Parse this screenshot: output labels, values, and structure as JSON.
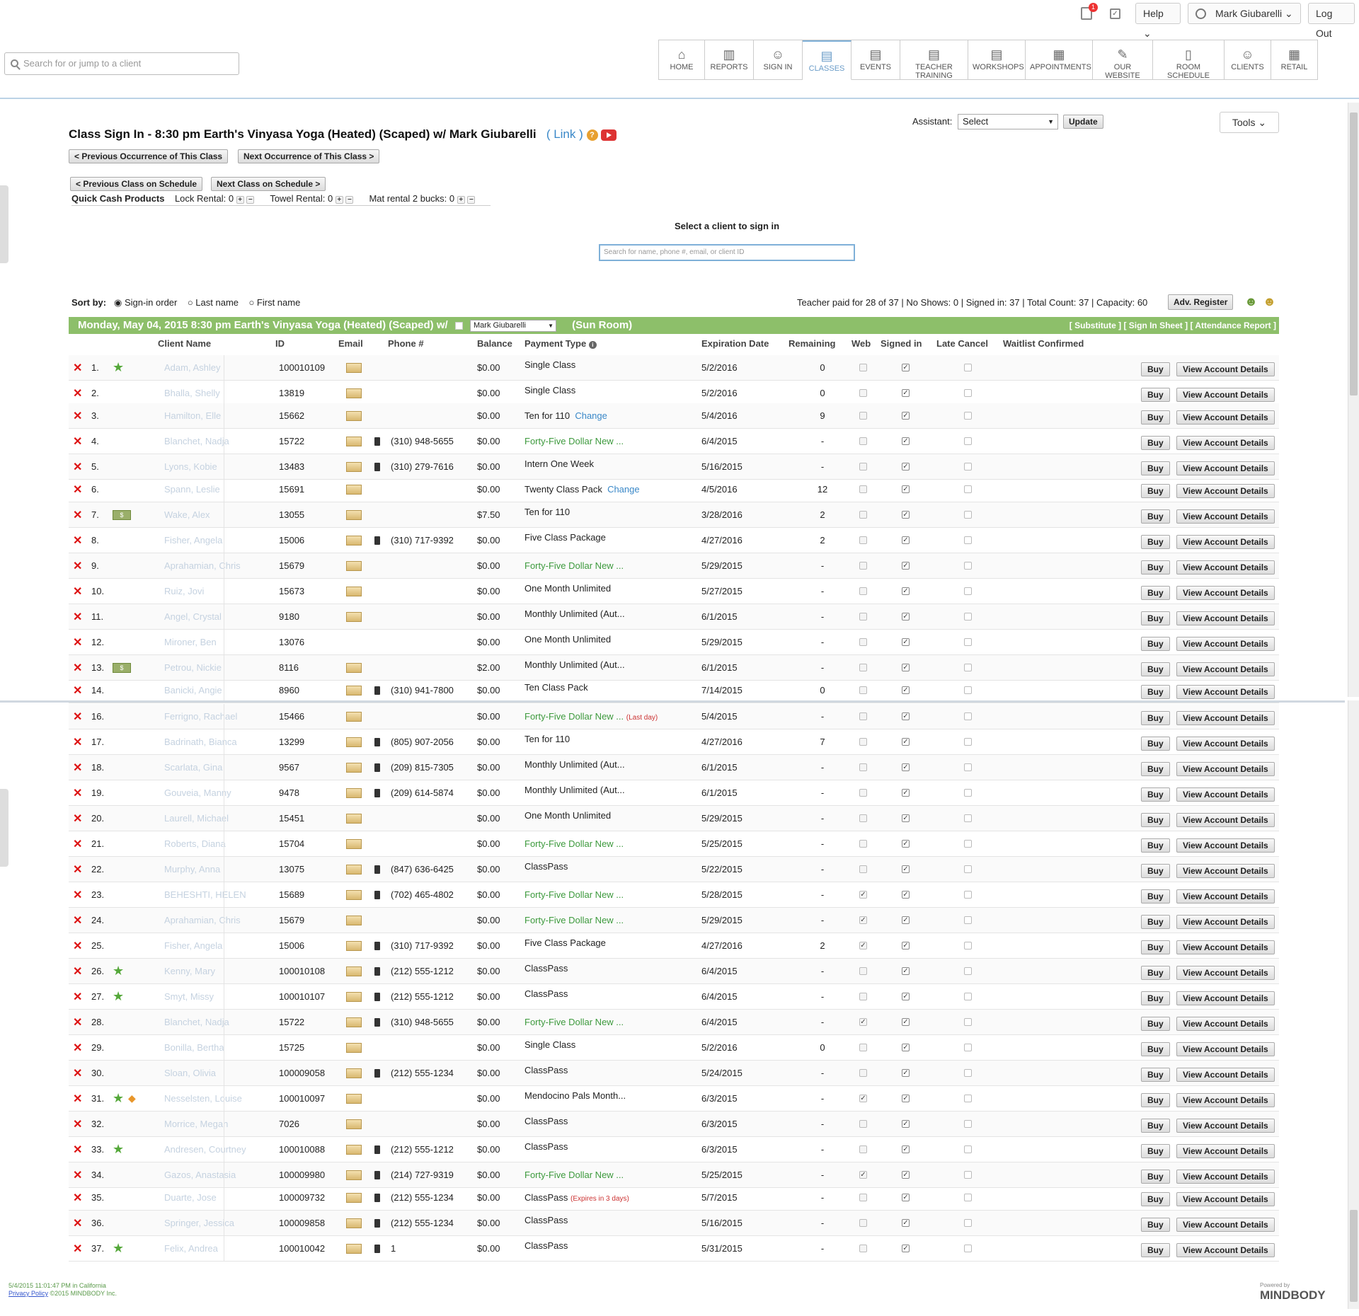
{
  "top": {
    "help": "Help",
    "user": "Mark Giubarelli",
    "logout": "Log Out",
    "badge": "1"
  },
  "search": {
    "placeholder": "Search for or jump to a client"
  },
  "nav": [
    {
      "label": "HOME",
      "icon": "home-icon",
      "glyph": "⌂"
    },
    {
      "label": "REPORTS",
      "icon": "reports-icon",
      "glyph": "▥"
    },
    {
      "label": "SIGN IN",
      "icon": "sign-in-icon",
      "glyph": "☺"
    },
    {
      "label": "CLASSES",
      "icon": "classes-icon",
      "glyph": "▤"
    },
    {
      "label": "EVENTS",
      "icon": "events-icon",
      "glyph": "▤"
    },
    {
      "label": "TEACHER TRAINING",
      "icon": "teacher-training-icon",
      "glyph": "▤"
    },
    {
      "label": "WORKSHOPS",
      "icon": "workshops-icon",
      "glyph": "▤"
    },
    {
      "label": "APPOINTMENTS",
      "icon": "appointments-icon",
      "glyph": "▦"
    },
    {
      "label": "OUR WEBSITE",
      "icon": "website-icon",
      "glyph": "✎"
    },
    {
      "label": "ROOM SCHEDULE",
      "icon": "room-schedule-icon",
      "glyph": "▯"
    },
    {
      "label": "CLIENTS",
      "icon": "clients-icon",
      "glyph": "☺"
    },
    {
      "label": "RETAIL",
      "icon": "retail-icon",
      "glyph": "▦"
    }
  ],
  "assistant": {
    "label": "Assistant:",
    "select": "Select",
    "update": "Update"
  },
  "tools": "Tools",
  "page_title": {
    "text": "Class Sign In  -  8:30 pm   Earth's Vinyasa Yoga (Heated) (Scaped) w/  Mark Giubarelli",
    "link": "Link",
    "help": "?"
  },
  "buttons": {
    "prev_occ": "< Previous Occurrence of This Class",
    "next_occ": "Next Occurrence of This Class >",
    "prev_class": "< Previous Class on Schedule",
    "next_class": "Next Class on Schedule >"
  },
  "quick_cash": {
    "label": "Quick Cash Products",
    "items": [
      {
        "name": "Lock Rental:",
        "count": "0"
      },
      {
        "name": "Towel Rental:",
        "count": "0"
      },
      {
        "name": "Mat rental 2 bucks:",
        "count": "0"
      }
    ]
  },
  "client_search": {
    "label": "Select a client to sign in",
    "placeholder": "Search for name, phone #, email, or client ID"
  },
  "sort": {
    "label": "Sort by:",
    "options": [
      "Sign-in order",
      "Last name",
      "First name"
    ]
  },
  "stats": "Teacher paid for 28 of 37 | No Shows: 0 | Signed in: 37 |  Total Count: 37  | Capacity: 60",
  "adv_register": "Adv. Register",
  "class_bar": {
    "text": "Monday, May 04, 2015   8:30 pm   Earth's Vinyasa Yoga (Heated) (Scaped)    w/",
    "teacher": "Mark Giubarelli",
    "room": "(Sun Room)",
    "links": "[ Substitute ]   [ Sign In Sheet ]   [ Attendance Report ]"
  },
  "columns": {
    "name": "Client Name",
    "id": "ID",
    "email": "Email",
    "phone": "Phone #",
    "balance": "Balance",
    "payment": "Payment Type",
    "exp": "Expiration Date",
    "remaining": "Remaining",
    "web": "Web",
    "signed": "Signed in",
    "late": "Late Cancel",
    "waitlist": "Waitlist Confirmed"
  },
  "row_buttons": {
    "buy": "Buy",
    "view": "View Account Details"
  },
  "rows": [
    {
      "n": "1.",
      "name": "Adam, Ashley",
      "id": "100010109",
      "email": true,
      "phone": "",
      "bal": "$0.00",
      "pay": "Single Class",
      "exp": "5/2/2016",
      "rem": "0",
      "star": true
    },
    {
      "n": "2.",
      "name": "Bhalla, Shelly",
      "id": "13819",
      "email": true,
      "phone": "",
      "bal": "$0.00",
      "pay": "Single Class",
      "exp": "5/2/2016",
      "rem": "0"
    },
    {
      "n": "3.",
      "name": "Hamilton, Elle",
      "id": "15662",
      "email": true,
      "phone": "",
      "bal": "$0.00",
      "pay": "Ten for 110",
      "change": "Change",
      "exp": "5/4/2016",
      "rem": "9"
    },
    {
      "n": "4.",
      "name": "Blanchet, Nadja",
      "id": "15722",
      "email": true,
      "phone": "(310) 948-5655",
      "bal": "$0.00",
      "pay": "Forty-Five Dollar New ...",
      "green": true,
      "exp": "6/4/2015",
      "rem": "-"
    },
    {
      "n": "5.",
      "name": "Lyons, Kobie",
      "id": "13483",
      "email": true,
      "phone": "(310) 279-7616",
      "bal": "$0.00",
      "pay": "Intern One Week",
      "exp": "5/16/2015",
      "rem": "-"
    },
    {
      "n": "6.",
      "name": "Spann, Leslie",
      "id": "15691",
      "email": true,
      "phone": "",
      "bal": "$0.00",
      "pay": "Twenty Class Pack",
      "change": "Change",
      "exp": "4/5/2016",
      "rem": "12"
    },
    {
      "n": "7.",
      "name": "Wake, Alex",
      "id": "13055",
      "email": true,
      "phone": "",
      "bal": "$7.50",
      "pay": "Ten for 110",
      "exp": "3/28/2016",
      "rem": "2",
      "cash": true
    },
    {
      "n": "8.",
      "name": "Fisher, Angela",
      "id": "15006",
      "email": true,
      "phone": "(310) 717-9392",
      "bal": "$0.00",
      "pay": "Five Class Package",
      "exp": "4/27/2016",
      "rem": "2"
    },
    {
      "n": "9.",
      "name": "Aprahamian, Chris",
      "id": "15679",
      "email": true,
      "phone": "",
      "bal": "$0.00",
      "pay": "Forty-Five Dollar New ...",
      "green": true,
      "exp": "5/29/2015",
      "rem": "-"
    },
    {
      "n": "10.",
      "name": "Ruiz, Jovi",
      "id": "15673",
      "email": true,
      "phone": "",
      "bal": "$0.00",
      "pay": "One Month Unlimited",
      "exp": "5/27/2015",
      "rem": "-"
    },
    {
      "n": "11.",
      "name": "Angel, Crystal",
      "id": "9180",
      "email": true,
      "phone": "",
      "bal": "$0.00",
      "pay": "Monthly Unlimited (Aut...",
      "exp": "6/1/2015",
      "rem": "-"
    },
    {
      "n": "12.",
      "name": "Mironer, Ben",
      "id": "13076",
      "email": false,
      "phone": "",
      "bal": "$0.00",
      "pay": "One Month Unlimited",
      "exp": "5/29/2015",
      "rem": "-"
    },
    {
      "n": "13.",
      "name": "Petrou, Nickie",
      "id": "8116",
      "email": true,
      "phone": "",
      "bal": "$2.00",
      "pay": "Monthly Unlimited (Aut...",
      "exp": "6/1/2015",
      "rem": "-",
      "cash": true
    },
    {
      "n": "14.",
      "name": "Banicki, Angie",
      "id": "8960",
      "email": true,
      "phone": "(310) 941-7800",
      "bal": "$0.00",
      "pay": "Ten Class Pack",
      "exp": "7/14/2015",
      "rem": "0"
    },
    {
      "n": "16.",
      "name": "Ferrigno, Rachael",
      "id": "15466",
      "email": true,
      "phone": "",
      "bal": "$0.00",
      "pay": "Forty-Five Dollar New ...",
      "green": true,
      "note": "(Last day)",
      "exp": "5/4/2015",
      "rem": "-"
    },
    {
      "n": "17.",
      "name": "Badrinath, Bianca",
      "id": "13299",
      "email": true,
      "phone": "(805) 907-2056",
      "bal": "$0.00",
      "pay": "Ten for 110",
      "exp": "4/27/2016",
      "rem": "7"
    },
    {
      "n": "18.",
      "name": "Scarlata, Gina",
      "id": "9567",
      "email": true,
      "phone": "(209) 815-7305",
      "bal": "$0.00",
      "pay": "Monthly Unlimited (Aut...",
      "exp": "6/1/2015",
      "rem": "-"
    },
    {
      "n": "19.",
      "name": "Gouveia, Manny",
      "id": "9478",
      "email": true,
      "phone": "(209) 614-5874",
      "bal": "$0.00",
      "pay": "Monthly Unlimited (Aut...",
      "exp": "6/1/2015",
      "rem": "-"
    },
    {
      "n": "20.",
      "name": "Laurell, Michael",
      "id": "15451",
      "email": true,
      "phone": "",
      "bal": "$0.00",
      "pay": "One Month Unlimited",
      "exp": "5/29/2015",
      "rem": "-"
    },
    {
      "n": "21.",
      "name": "Roberts, Diana",
      "id": "15704",
      "email": true,
      "phone": "",
      "bal": "$0.00",
      "pay": "Forty-Five Dollar New ...",
      "green": true,
      "exp": "5/25/2015",
      "rem": "-"
    },
    {
      "n": "22.",
      "name": "Murphy, Anna",
      "id": "13075",
      "email": true,
      "phone": "(847) 636-6425",
      "bal": "$0.00",
      "pay": "ClassPass",
      "exp": "5/22/2015",
      "rem": "-"
    },
    {
      "n": "23.",
      "name": "BEHESHTI, HELEN",
      "id": "15689",
      "email": true,
      "phone": "(702) 465-4802",
      "bal": "$0.00",
      "pay": "Forty-Five Dollar New ...",
      "green": true,
      "exp": "5/28/2015",
      "rem": "-",
      "web": true
    },
    {
      "n": "24.",
      "name": "Aprahamian, Chris",
      "id": "15679",
      "email": true,
      "phone": "",
      "bal": "$0.00",
      "pay": "Forty-Five Dollar New ...",
      "green": true,
      "exp": "5/29/2015",
      "rem": "-",
      "web": true
    },
    {
      "n": "25.",
      "name": "Fisher, Angela",
      "id": "15006",
      "email": true,
      "phone": "(310) 717-9392",
      "bal": "$0.00",
      "pay": "Five Class Package",
      "exp": "4/27/2016",
      "rem": "2",
      "web": true
    },
    {
      "n": "26.",
      "name": "Kenny, Mary",
      "id": "100010108",
      "email": true,
      "phone": "(212) 555-1212",
      "bal": "$0.00",
      "pay": "ClassPass",
      "exp": "6/4/2015",
      "rem": "-",
      "star": true
    },
    {
      "n": "27.",
      "name": "Smyt, Missy",
      "id": "100010107",
      "email": true,
      "phone": "(212) 555-1212",
      "bal": "$0.00",
      "pay": "ClassPass",
      "exp": "6/4/2015",
      "rem": "-",
      "star": true
    },
    {
      "n": "28.",
      "name": "Blanchet, Nadja",
      "id": "15722",
      "email": true,
      "phone": "(310) 948-5655",
      "bal": "$0.00",
      "pay": "Forty-Five Dollar New ...",
      "green": true,
      "exp": "6/4/2015",
      "rem": "-",
      "web": true
    },
    {
      "n": "29.",
      "name": "Bonilla, Bertha",
      "id": "15725",
      "email": true,
      "phone": "",
      "bal": "$0.00",
      "pay": "Single Class",
      "exp": "5/2/2016",
      "rem": "0"
    },
    {
      "n": "30.",
      "name": "Sloan, Olivia",
      "id": "100009058",
      "email": true,
      "phone": "(212) 555-1234",
      "bal": "$0.00",
      "pay": "ClassPass",
      "exp": "5/24/2015",
      "rem": "-"
    },
    {
      "n": "31.",
      "name": "Nesselsten, Louise",
      "id": "100010097",
      "email": true,
      "phone": "",
      "bal": "$0.00",
      "pay": "Mendocino Pals Month...",
      "exp": "6/3/2015",
      "rem": "-",
      "star": true,
      "fish": true,
      "web": true
    },
    {
      "n": "32.",
      "name": "Morrice, Megan",
      "id": "7026",
      "email": true,
      "phone": "",
      "bal": "$0.00",
      "pay": "ClassPass",
      "exp": "6/3/2015",
      "rem": "-"
    },
    {
      "n": "33.",
      "name": "Andresen, Courtney",
      "id": "100010088",
      "email": true,
      "phone": "(212) 555-1212",
      "bal": "$0.00",
      "pay": "ClassPass",
      "exp": "6/3/2015",
      "rem": "-",
      "star": true
    },
    {
      "n": "34.",
      "name": "Gazos, Anastasia",
      "id": "100009980",
      "email": true,
      "phone": "(214) 727-9319",
      "bal": "$0.00",
      "pay": "Forty-Five Dollar New ...",
      "green": true,
      "exp": "5/25/2015",
      "rem": "-",
      "web": true
    },
    {
      "n": "35.",
      "name": "Duarte, Jose",
      "id": "100009732",
      "email": true,
      "phone": "(212) 555-1234",
      "bal": "$0.00",
      "pay": "ClassPass",
      "note": "(Expires in 3 days)",
      "exp": "5/7/2015",
      "rem": "-"
    },
    {
      "n": "36.",
      "name": "Springer, Jessica",
      "id": "100009858",
      "email": true,
      "phone": "(212) 555-1234",
      "bal": "$0.00",
      "pay": "ClassPass",
      "exp": "5/16/2015",
      "rem": "-"
    },
    {
      "n": "37.",
      "name": "Felix, Andrea",
      "id": "100010042",
      "email": true,
      "phone": "1",
      "bal": "$0.00",
      "pay": "ClassPass",
      "exp": "5/31/2015",
      "rem": "-",
      "star": true
    }
  ],
  "footer": {
    "time": "5/4/2015 11:01:47 PM in California",
    "privacy": "Privacy Policy",
    "copy": "©2015 MINDBODY Inc."
  },
  "logo": {
    "powered": "Powered by",
    "name": "MINDBODY"
  }
}
